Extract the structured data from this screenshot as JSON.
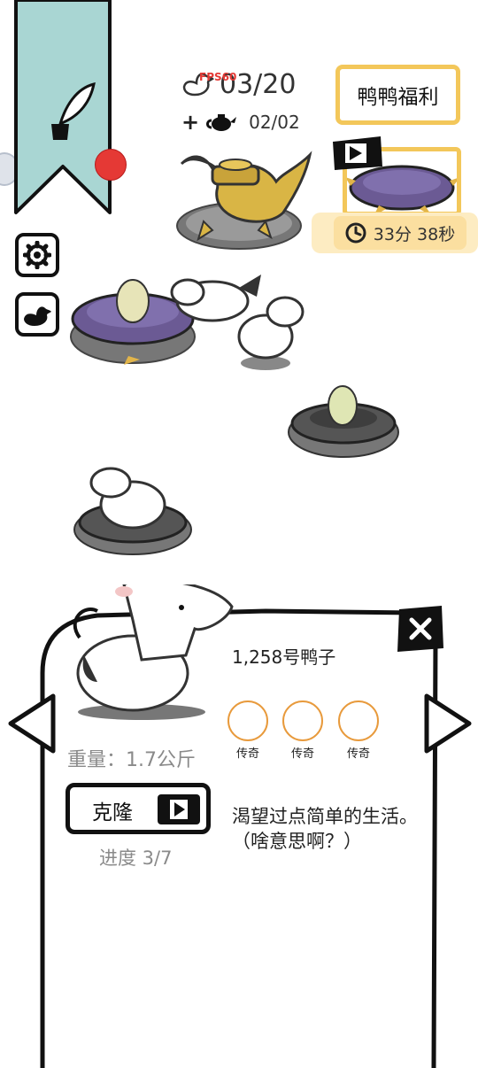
{
  "counter": {
    "duck_count": "03/20",
    "fps_badge": "FPS60",
    "teapot_count": "02/02",
    "plus": "+"
  },
  "welfare": {
    "label": "鸭鸭福利",
    "timer": "33分 38秒"
  },
  "duck_info": {
    "name": "1,258号鸭子",
    "traits": [
      {
        "label": "传奇"
      },
      {
        "label": "传奇"
      },
      {
        "label": "传奇"
      }
    ],
    "weight": "重量：1.7公斤",
    "clone_label": "克隆",
    "progress": "进度 3/7",
    "description": "渴望过点简单的生活。\n（啥意思啊？）"
  },
  "colors": {
    "ribbon": "#a9d6d3",
    "accent_gold": "#f3c75a",
    "timer_bg": "#fdecc2",
    "cushion_purple": "#6b5a94",
    "notification_red": "#e53935",
    "trait_ring": "#e89a3c"
  },
  "icons": [
    "quill-ink-icon",
    "gear-icon",
    "duck-icon",
    "duck-outline-icon",
    "teapot-icon",
    "play-icon",
    "clock-icon",
    "close-icon",
    "left-arrow-icon",
    "right-arrow-icon"
  ]
}
